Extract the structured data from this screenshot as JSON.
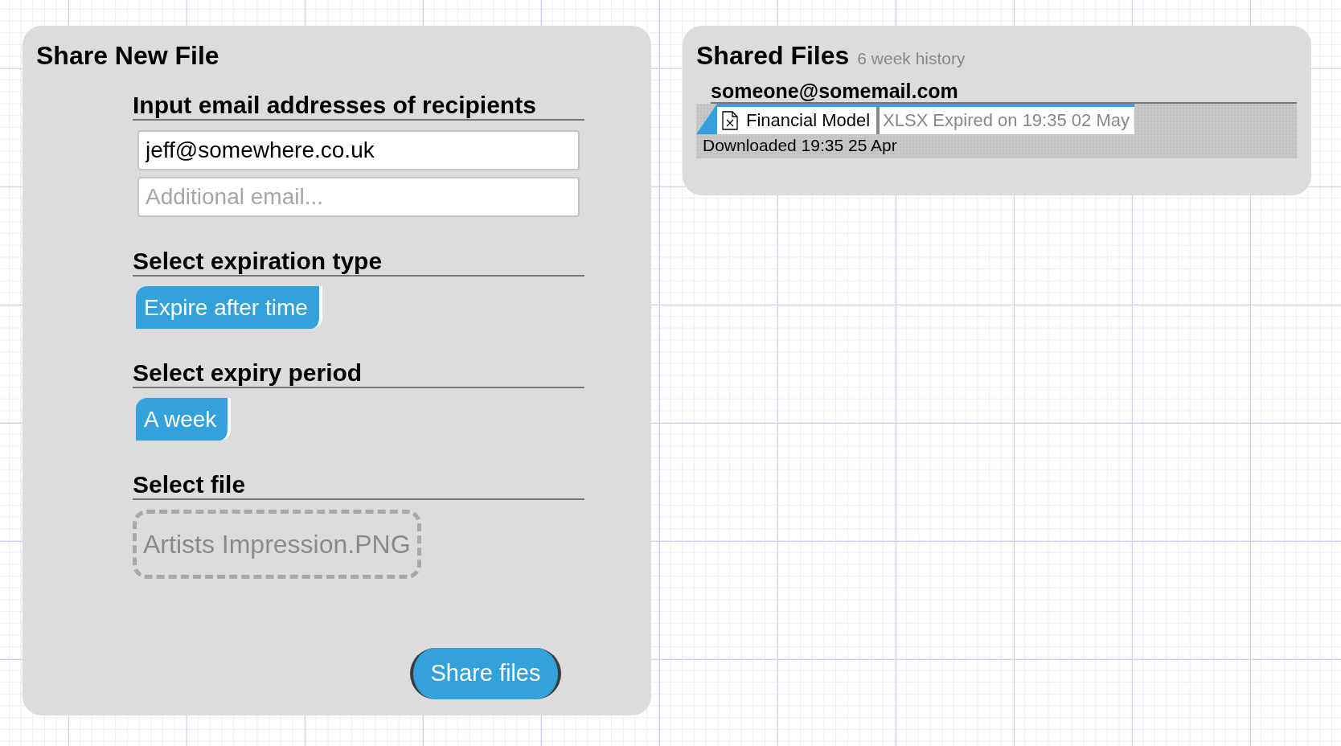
{
  "share_panel": {
    "title": "Share New File",
    "sections": [
      {
        "kind": "emails",
        "heading": "Input email addresses of recipients",
        "fields": [
          {
            "value": "jeff@somewhere.co.uk"
          },
          {
            "placeholder": "Additional email..."
          }
        ]
      },
      {
        "kind": "choice",
        "heading": "Select expiration type",
        "option": {
          "label": "Expire after time",
          "selected": true
        }
      },
      {
        "kind": "choice",
        "heading": "Select expiry period",
        "option": {
          "label": "A week",
          "selected": true
        }
      },
      {
        "kind": "file",
        "heading": "Select file",
        "file_name": "Artists Impression.PNG"
      }
    ],
    "submit": "Share files"
  },
  "shared_panel": {
    "title": "Shared Files",
    "subtitle": "6 week history",
    "recipients": [
      {
        "email": "someone@somemail.com",
        "files": [
          {
            "name": "Financial Model",
            "type": "XLSX",
            "status": "Expired on 19:35 02 May",
            "downloaded": "Downloaded 19:35 25 Apr"
          }
        ]
      }
    ]
  }
}
